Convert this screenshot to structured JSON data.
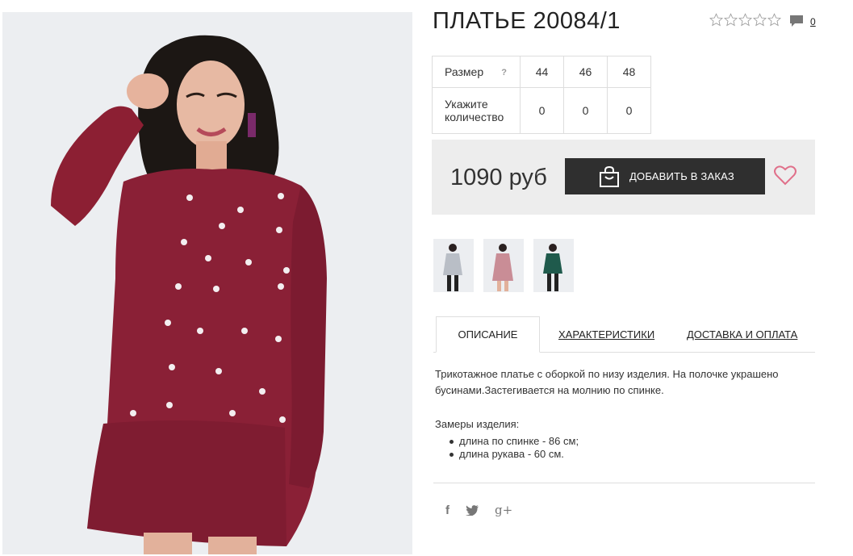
{
  "product": {
    "title": "ПЛАТЬЕ 20084/1",
    "rating_icon": "star-outline-icon",
    "rating_stars": 5,
    "rating_value": 0,
    "comments_icon": "comment-icon",
    "comments_count": "0",
    "image_alt": "Model in burgundy knit dress with pearl beads"
  },
  "size_table": {
    "size_label": "Размер",
    "help_mark": "?",
    "sizes": [
      "44",
      "46",
      "48"
    ],
    "qty_label_line1": "Укажите",
    "qty_label_line2": "количество",
    "quantities": [
      "0",
      "0",
      "0"
    ]
  },
  "buy": {
    "price": "1090 руб",
    "add_button": "ДОБАВИТЬ В ЗАКАЗ",
    "bag_icon": "shopping-bag-icon",
    "wish_icon": "heart-icon",
    "button_color": "#2f2f2f",
    "heart_color": "#e0708a"
  },
  "thumbnails": [
    {
      "name": "thumb-grey",
      "color": "#b9bec6"
    },
    {
      "name": "thumb-pink",
      "color": "#c98d96"
    },
    {
      "name": "thumb-green",
      "color": "#1f5a4c"
    }
  ],
  "tabs": {
    "description": "ОПИСАНИЕ",
    "specs": "ХАРАКТЕРИСТИКИ",
    "delivery": "ДОСТАВКА И ОПЛАТА"
  },
  "description": {
    "text": "Трикотажное платье с оборкой по низу изделия. На полочке украшено бусинами.Застегивается на молнию по спинке.",
    "measure_title": "Замеры изделия:",
    "measures": [
      "длина по спинке - 86 см;",
      "длина рукава - 60 см."
    ]
  },
  "social": {
    "facebook": "f",
    "twitter": "🐦",
    "gplus": "g+"
  }
}
